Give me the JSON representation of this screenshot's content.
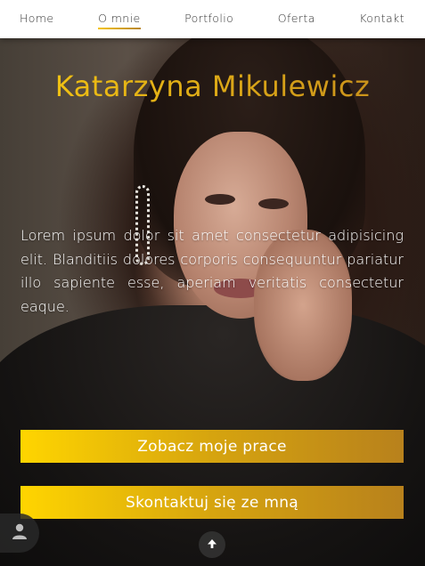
{
  "nav": {
    "items": [
      {
        "label": "Home",
        "active": false
      },
      {
        "label": "O mnie",
        "active": true
      },
      {
        "label": "Portfolio",
        "active": false
      },
      {
        "label": "Oferta",
        "active": false
      },
      {
        "label": "Kontakt",
        "active": false
      }
    ]
  },
  "hero": {
    "title": "Katarzyna Mikulewicz",
    "lead": "Lorem ipsum dolor sit amet consectetur adipisicing elit. Blanditiis dolores corporis consequuntur pariatur illo sapiente esse, aperiam veritatis consectetur eaque.",
    "buttons": {
      "portfolio": "Zobacz moje prace",
      "contact": "Skontaktuj się ze mną"
    }
  },
  "icons": {
    "user": "user-icon",
    "scroll_top": "arrow-up-icon"
  },
  "colors": {
    "accent_start": "#ffd500",
    "accent_end": "#b8811c",
    "title": "#e9b31c"
  }
}
